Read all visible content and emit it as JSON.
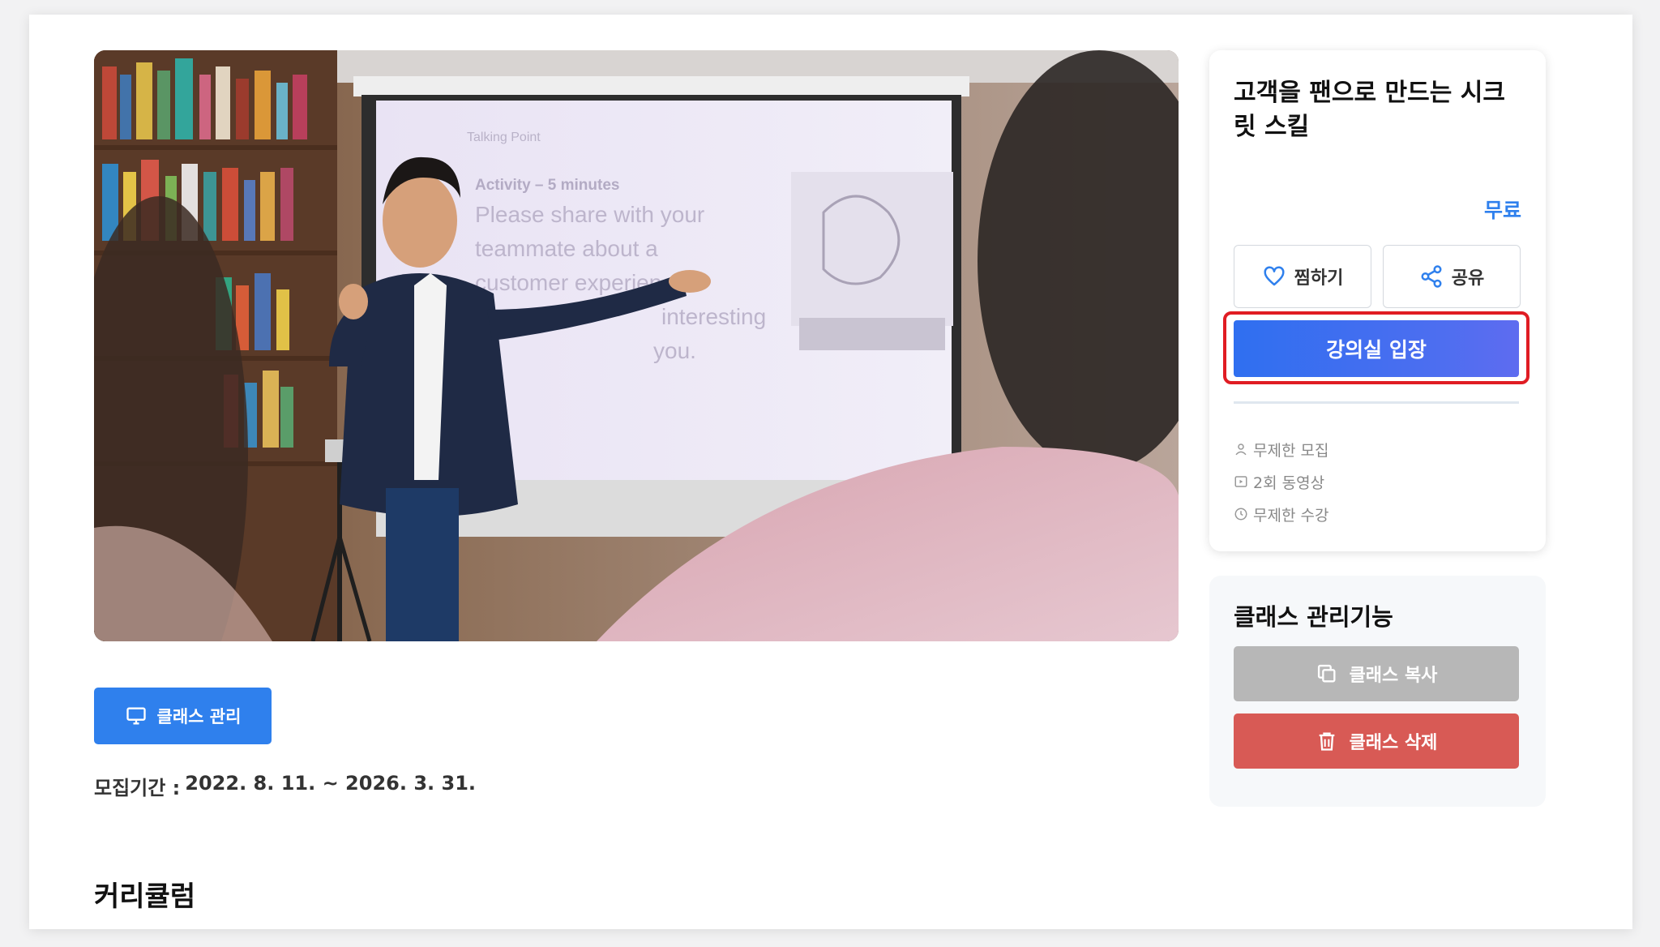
{
  "course": {
    "title": "고객을 팬으로 만드는 시크릿 스킬",
    "price": "무료"
  },
  "actions": {
    "wish_label": "찜하기",
    "share_label": "공유",
    "enter_label": "강의실 입장"
  },
  "meta": {
    "recruit": "무제한 모집",
    "videos": "2회 동영상",
    "duration": "무제한 수강"
  },
  "admin": {
    "title": "클래스 관리기능",
    "copy_label": "클래스 복사",
    "delete_label": "클래스 삭제"
  },
  "left": {
    "manage_label": "클래스 관리",
    "period_label": "모집기간 :",
    "period_value": "2022. 8. 11. ~ 2026. 3. 31.",
    "curriculum_title": "커리큘럼"
  },
  "hero": {
    "slide_heading": "Talking Point",
    "slide_activity": "Activity – 5 minutes",
    "slide_body": [
      "Please share with your",
      "teammate about a",
      "customer experience",
      "interesting",
      "you."
    ]
  },
  "colors": {
    "accent": "#2f80ed",
    "danger": "#d85a55",
    "highlight": "#e01c23",
    "disabled": "#b7b7b7"
  }
}
